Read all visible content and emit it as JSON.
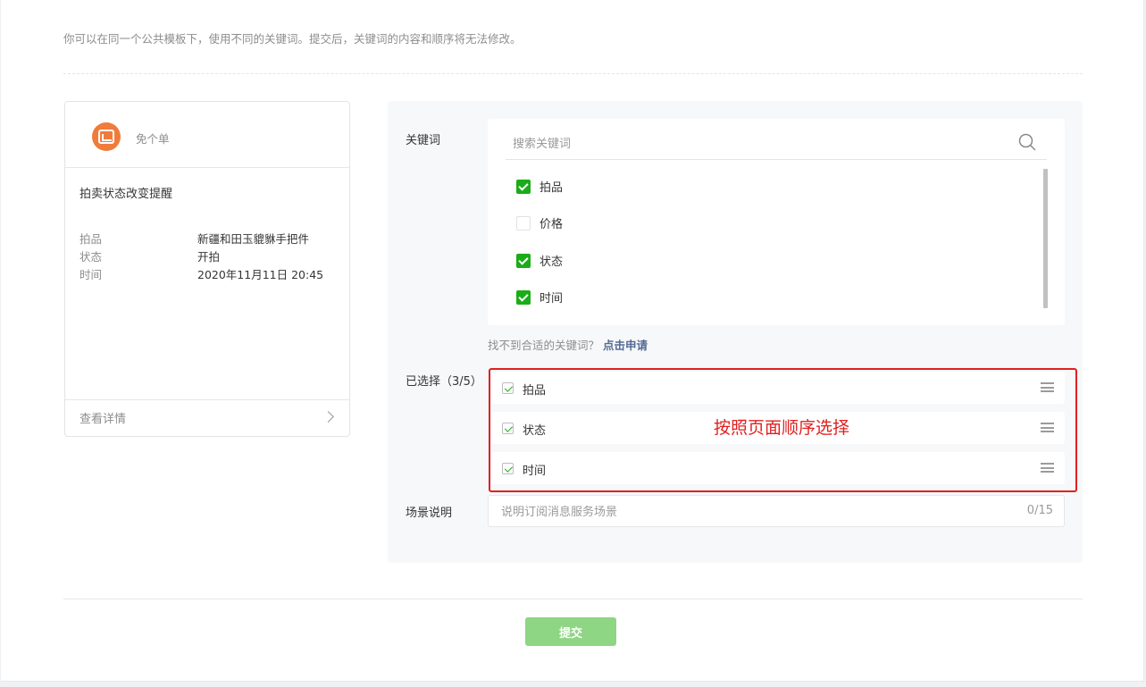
{
  "intro": "你可以在同一个公共模板下，使用不同的关键词。提交后，关键词的内容和顺序将无法修改。",
  "preview": {
    "brand": "免个单",
    "title": "拍卖状态改变提醒",
    "fields": [
      {
        "key": "拍品",
        "value": "新疆和田玉貔貅手把件"
      },
      {
        "key": "状态",
        "value": "开拍"
      },
      {
        "key": "时间",
        "value": "2020年11月11日 20:45"
      }
    ],
    "detail_link": "查看详情"
  },
  "keywords": {
    "label": "关键词",
    "search_placeholder": "搜索关键词",
    "options": [
      {
        "label": "拍品",
        "checked": true
      },
      {
        "label": "价格",
        "checked": false
      },
      {
        "label": "状态",
        "checked": true
      },
      {
        "label": "时间",
        "checked": true
      }
    ],
    "hint": "找不到合适的关键词？",
    "apply_link": "点击申请"
  },
  "selected": {
    "label": "已选择（3/5）",
    "items": [
      "拍品",
      "状态",
      "时间"
    ],
    "annotation": "按照页面顺序选择"
  },
  "scene": {
    "label": "场景说明",
    "placeholder": "说明订阅消息服务场景",
    "count": "0/15"
  },
  "submit_label": "提交",
  "colors": {
    "accent": "#1aad19",
    "annotation": "#e02020",
    "submit_disabled": "#8ed584",
    "link": "#576b95"
  }
}
